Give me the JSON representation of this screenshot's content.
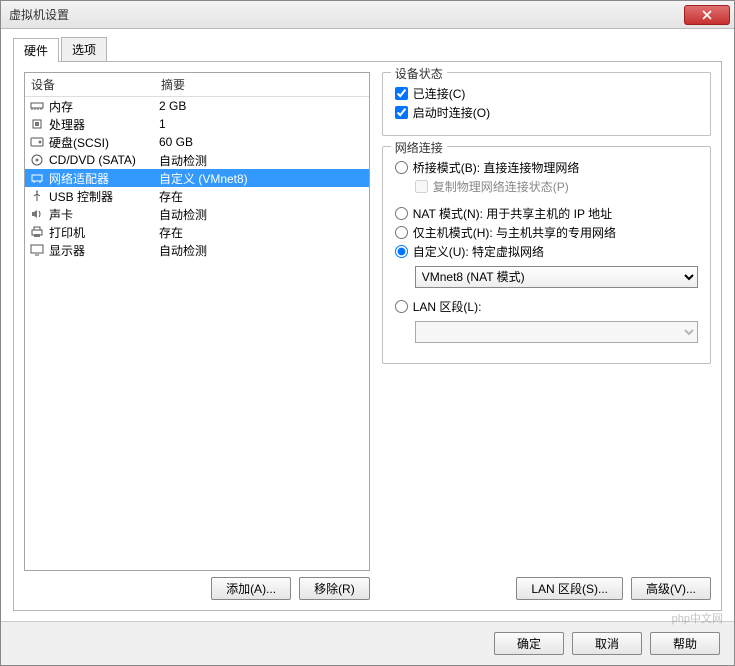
{
  "window": {
    "title": "虚拟机设置"
  },
  "tabs": {
    "hardware": "硬件",
    "options": "选项"
  },
  "devlist": {
    "header": {
      "device": "设备",
      "summary": "摘要"
    },
    "rows": [
      {
        "icon": "memory-icon",
        "name": "内存",
        "summary": "2 GB"
      },
      {
        "icon": "cpu-icon",
        "name": "处理器",
        "summary": "1"
      },
      {
        "icon": "disk-icon",
        "name": "硬盘(SCSI)",
        "summary": "60 GB"
      },
      {
        "icon": "cd-icon",
        "name": "CD/DVD (SATA)",
        "summary": "自动检测"
      },
      {
        "icon": "nic-icon",
        "name": "网络适配器",
        "summary": "自定义 (VMnet8)"
      },
      {
        "icon": "usb-icon",
        "name": "USB 控制器",
        "summary": "存在"
      },
      {
        "icon": "sound-icon",
        "name": "声卡",
        "summary": "自动检测"
      },
      {
        "icon": "printer-icon",
        "name": "打印机",
        "summary": "存在"
      },
      {
        "icon": "display-icon",
        "name": "显示器",
        "summary": "自动检测"
      }
    ]
  },
  "leftbtns": {
    "add": "添加(A)...",
    "remove": "移除(R)"
  },
  "status": {
    "legend": "设备状态",
    "connected": "已连接(C)",
    "connect_on_power": "启动时连接(O)"
  },
  "netconn": {
    "legend": "网络连接",
    "bridged": "桥接模式(B): 直接连接物理网络",
    "replicate": "复制物理网络连接状态(P)",
    "nat": "NAT 模式(N): 用于共享主机的 IP 地址",
    "hostonly": "仅主机模式(H): 与主机共享的专用网络",
    "custom": "自定义(U): 特定虚拟网络",
    "custom_value": "VMnet8 (NAT 模式)",
    "lan": "LAN 区段(L):",
    "lan_value": ""
  },
  "rightbtns": {
    "lan": "LAN 区段(S)...",
    "advanced": "高级(V)..."
  },
  "footer": {
    "ok": "确定",
    "cancel": "取消",
    "help": "帮助"
  },
  "watermark": "php中文网"
}
